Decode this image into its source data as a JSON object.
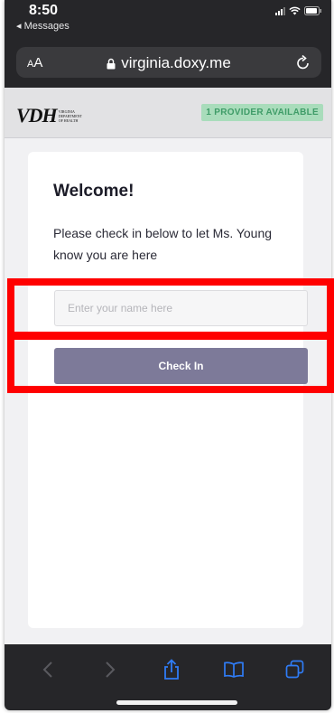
{
  "status_bar": {
    "time": "8:50",
    "back_app": "◂ Messages"
  },
  "browser": {
    "text_size_label": "A",
    "text_size_label_large": "A",
    "url": "virginia.doxy.me"
  },
  "site": {
    "logo_text": "VDH",
    "logo_subtext": "Virginia Department of Health",
    "provider_badge": "1 PROVIDER AVAILABLE"
  },
  "checkin": {
    "heading": "Welcome!",
    "instructions": "Please check in below to let Ms. Young know you are here",
    "name_placeholder": "Enter your name here",
    "name_value": "",
    "button_label": "Check In"
  },
  "colors": {
    "browser_chrome": "#262629",
    "accent_button": "#7d7a99",
    "badge_bg": "#a9dcbb",
    "badge_text": "#3f9c68",
    "toolbar_active": "#2f7cf6",
    "toolbar_disabled": "#5a5a5f",
    "highlight": "#ff0000"
  },
  "icons": {
    "toolbar": [
      "back-arrow-icon",
      "forward-arrow-icon",
      "share-icon",
      "bookmarks-icon",
      "tabs-icon"
    ]
  }
}
